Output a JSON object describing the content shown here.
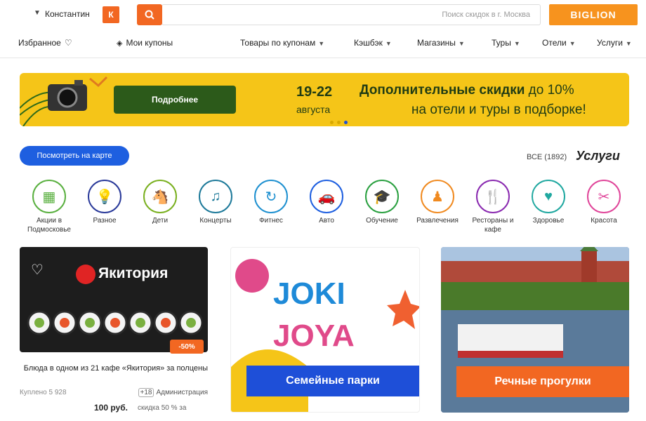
{
  "header": {
    "logo_text": "BIGLION",
    "search_placeholder": "Поиск скидок в г. Москва",
    "user_initial": "К",
    "user_name": "Константин",
    "favorites": "Избранное",
    "my_coupons": "Мои купоны"
  },
  "nav": {
    "items": [
      "Услуги",
      "Отели",
      "Туры",
      "Магазины",
      "Кэшбэк",
      "Товары по купонам"
    ]
  },
  "banner": {
    "title_bold": "Дополнительные скидки",
    "title_rest": "до 10%",
    "subtitle": "на отели и туры в подборке!",
    "date": "19-22",
    "month": "августа",
    "button": "Подробнее"
  },
  "services": {
    "title": "Услуги",
    "count": "ВСЕ (1892)",
    "map_button": "Посмотреть на карте",
    "categories": [
      {
        "label": "Красота",
        "icon": "✂",
        "color": "#e0469a"
      },
      {
        "label": "Здоровье",
        "icon": "♥",
        "color": "#20a8a0"
      },
      {
        "label": "Рестораны и кафе",
        "icon": "🍴",
        "color": "#8a2ab0"
      },
      {
        "label": "Развлечения",
        "icon": "♟",
        "color": "#f08a20"
      },
      {
        "label": "Обучение",
        "icon": "🎓",
        "color": "#2aa040"
      },
      {
        "label": "Авто",
        "icon": "🚗",
        "color": "#1e5fe0"
      },
      {
        "label": "Фитнес",
        "icon": "↻",
        "color": "#1e90d0"
      },
      {
        "label": "Концерты",
        "icon": "♫",
        "color": "#1e7a9a"
      },
      {
        "label": "Дети",
        "icon": "🐴",
        "color": "#7ab020"
      },
      {
        "label": "Разное",
        "icon": "💡",
        "color": "#2a3a9a"
      },
      {
        "label": "Акции в Подмосковье",
        "icon": "▦",
        "color": "#5ab040"
      }
    ]
  },
  "cards": {
    "a_title": "Якитория",
    "discount": "-50%",
    "desc": "Блюда в одном из 21 кафе «Якитория» за полцены",
    "brand": "Администрация",
    "brand_age": "+18",
    "coupons": "Куплено 5 928",
    "old_price": "скидка 50 % за",
    "price": "100 руб.",
    "b_label": "Семейные парки",
    "c_label": "Речные прогулки"
  }
}
